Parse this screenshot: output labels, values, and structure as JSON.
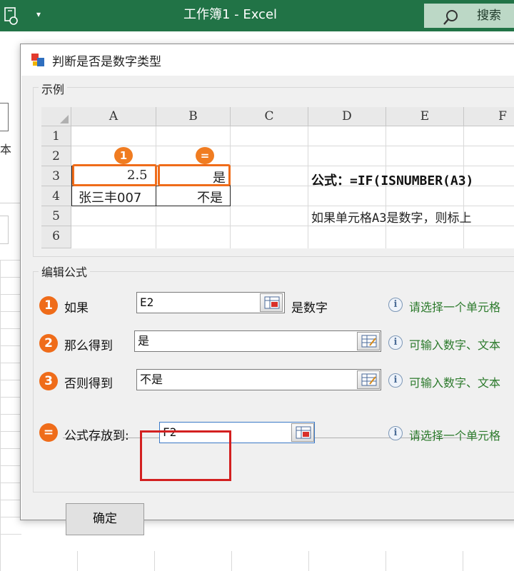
{
  "excel": {
    "title": "工作簿1  -  Excel",
    "search_label": "搜索",
    "ribbon_text": "本",
    "accent_color": "#217346",
    "icons": [
      "document-icon",
      "dropdown-arrow-icon",
      "search-icon"
    ]
  },
  "dialog": {
    "title": "判断是否是数字类型",
    "example_group": {
      "legend": "示例",
      "columns": [
        "A",
        "B",
        "C",
        "D",
        "E",
        "F"
      ],
      "rows": [
        "1",
        "2",
        "3",
        "4",
        "5",
        "6"
      ],
      "cells": {
        "a3": "2.5",
        "b3": "是",
        "a4": "张三丰007",
        "b4": "不是"
      },
      "badges": {
        "a3": "1",
        "b3": "="
      },
      "formula": "公式：=IF(ISNUMBER(A3)",
      "description": "如果单元格A3是数字，则标上"
    },
    "edit_group": {
      "legend": "编辑公式",
      "rows": [
        {
          "badge": "1",
          "label": "如果",
          "value": "E2",
          "after": "是数字",
          "hint": "请选择一个单元格"
        },
        {
          "badge": "2",
          "label": "那么得到",
          "value": "是",
          "after": "",
          "hint": "可输入数字、文本"
        },
        {
          "badge": "3",
          "label": "否则得到",
          "value": "不是",
          "after": "",
          "hint": "可输入数字、文本"
        },
        {
          "badge": "=",
          "label": "公式存放到:",
          "value": "F2",
          "after": "",
          "hint": "请选择一个单元格"
        }
      ],
      "info_glyph": "i"
    },
    "ok_label": "确定",
    "highlight_color": "#ef6c1a",
    "focus_color": "#d32020",
    "hint_color": "#2c7a2c"
  }
}
